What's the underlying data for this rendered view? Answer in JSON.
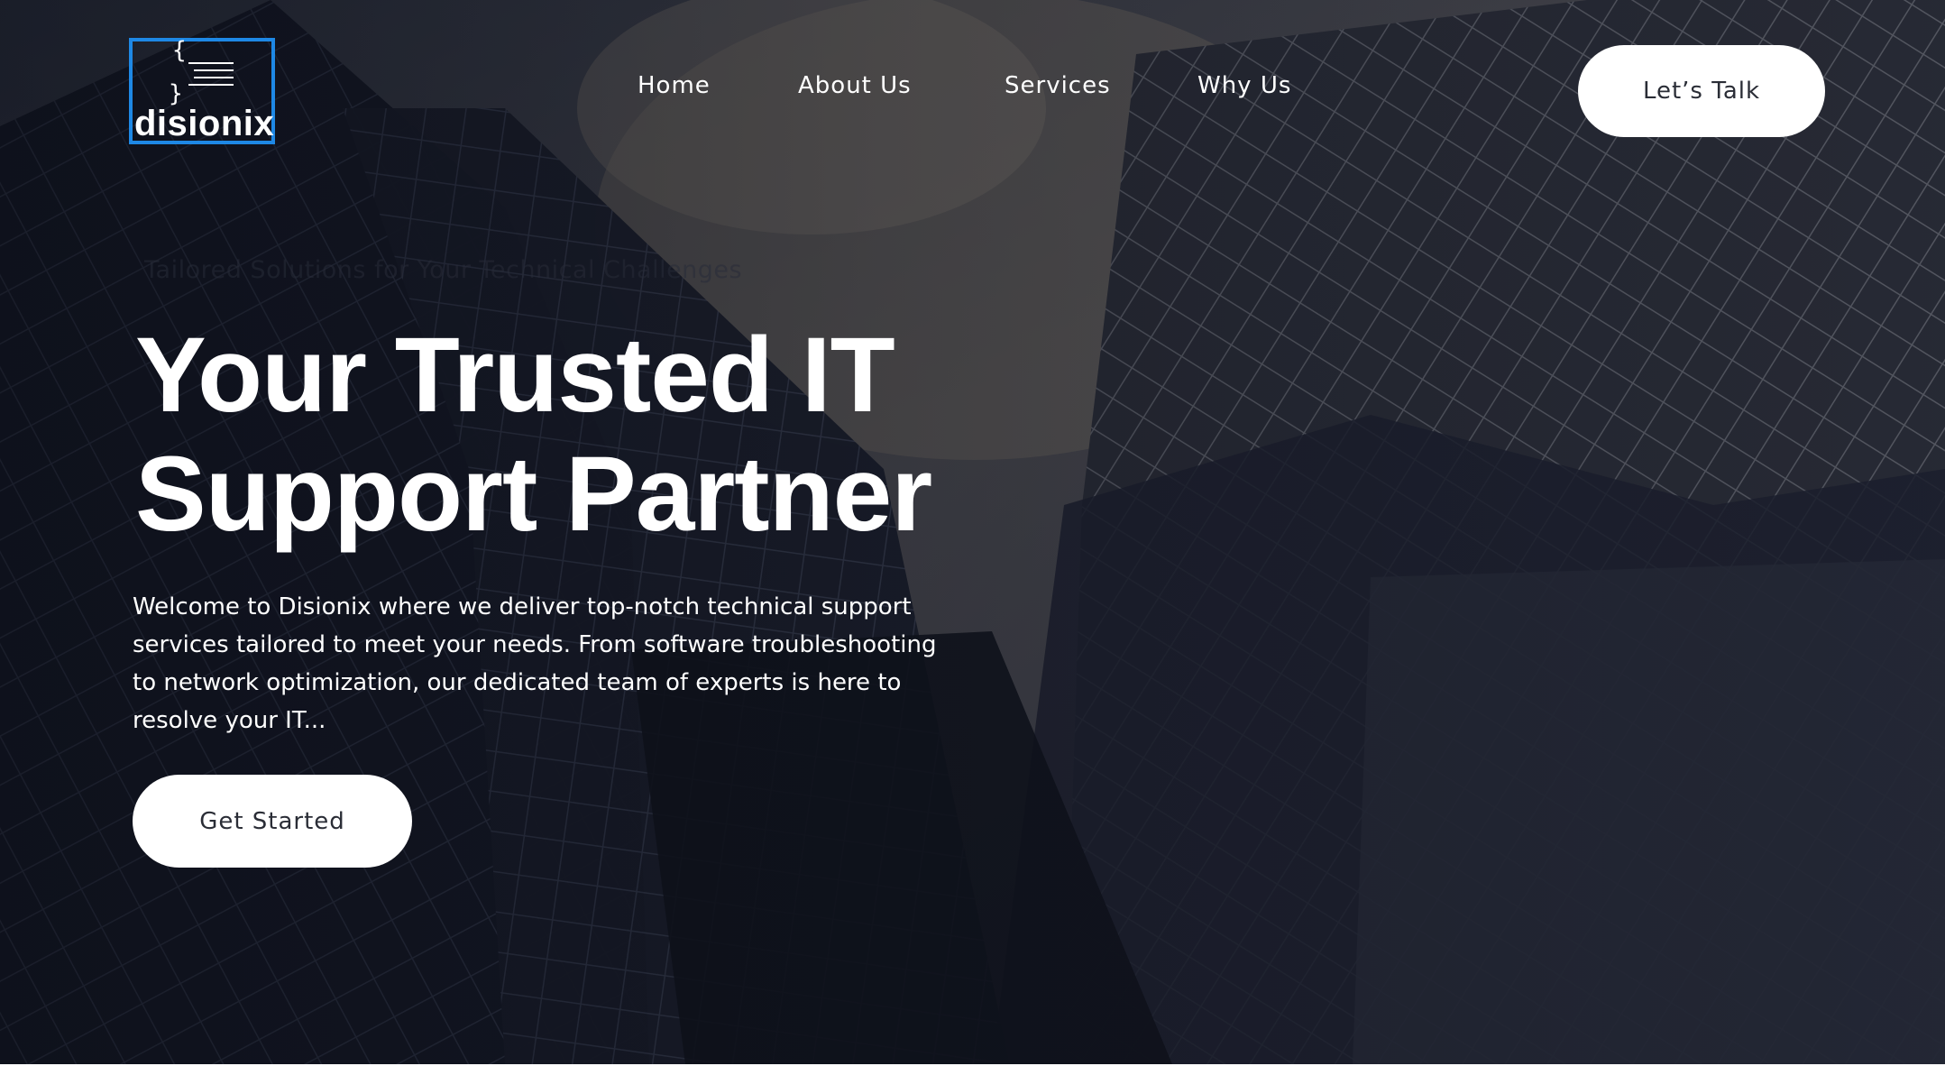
{
  "header": {
    "logo_text": "disionix",
    "logo_top_brace": "{",
    "logo_bottom_brace": "}",
    "nav": [
      {
        "label": "Home"
      },
      {
        "label": "About Us"
      },
      {
        "label": "Services"
      },
      {
        "label": "Why Us"
      }
    ],
    "cta_label": "Let’s Talk"
  },
  "hero": {
    "tagline": "Tailored Solutions for Your Technical Challenges",
    "headline_line1": "Your Trusted IT",
    "headline_line2": "Support Partner",
    "description": "Welcome to Disionix where we deliver top-notch technical support services tailored to meet your needs. From software troubleshooting to network optimization, our dedicated team of experts is here to resolve your IT...",
    "cta_label": "Get Started"
  },
  "colors": {
    "logo_border": "#1e88e5",
    "text_light": "#ffffff",
    "button_bg": "#ffffff",
    "button_text": "#2a2d36"
  }
}
